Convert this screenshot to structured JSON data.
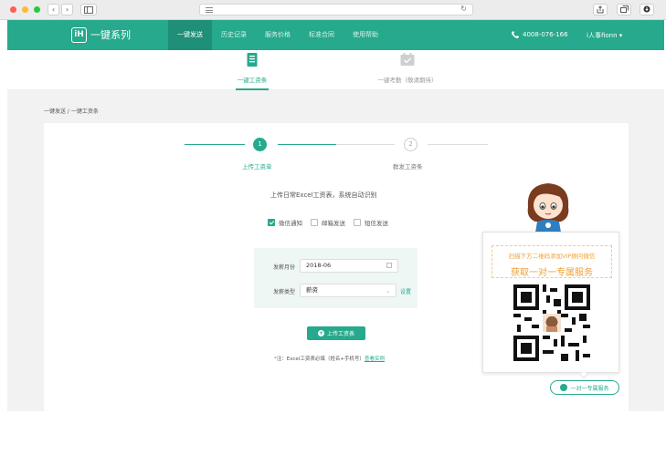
{
  "browser": {
    "back_label": "‹",
    "forward_label": "›",
    "reload_icon": "↻"
  },
  "nav": {
    "logo_mark": "iH",
    "logo_text": "一键系列",
    "items": [
      {
        "label": "一键发送",
        "active": true
      },
      {
        "label": "历史记录",
        "active": false
      },
      {
        "label": "服务价格",
        "active": false
      },
      {
        "label": "标准合同",
        "active": false
      },
      {
        "label": "使用帮助",
        "active": false
      }
    ],
    "phone": "4008-076-166",
    "user": "i人事fionn ▾"
  },
  "subtabs": [
    {
      "label": "一键工资条",
      "icon": "payslip-icon",
      "active": true
    },
    {
      "label": "一键考勤（敬请期待）",
      "icon": "calendar-check-icon",
      "active": false
    }
  ],
  "breadcrumb": "一键发送 / 一键工资条",
  "stepper": {
    "steps": [
      {
        "number": "1",
        "label": "上传工资单",
        "active": true
      },
      {
        "number": "2",
        "label": "群发工资条",
        "active": false
      }
    ]
  },
  "upload": {
    "hint": "上传日常Excel工资表，系统自动识别",
    "channels": [
      {
        "label": "微信通知",
        "checked": true
      },
      {
        "label": "邮箱发送",
        "checked": false
      },
      {
        "label": "短信发送",
        "checked": false
      }
    ],
    "month_label": "发薪月份",
    "month_value": "2018-06",
    "type_label": "发薪类型",
    "type_value": "薪资",
    "settings_link": "设置",
    "button_label": "上传工资表",
    "note_prefix": "*",
    "note_text": "注：Excel工资表必填（姓名+手机号）",
    "note_link": "查看实例"
  },
  "vip": {
    "line1": "扫描下方二维码添加VIP顾问微信",
    "line2": "获取一对一专属服务",
    "service_button": "一对一专属服务"
  },
  "colors": {
    "brand": "#26a98c",
    "accent_orange": "#f0a035"
  }
}
